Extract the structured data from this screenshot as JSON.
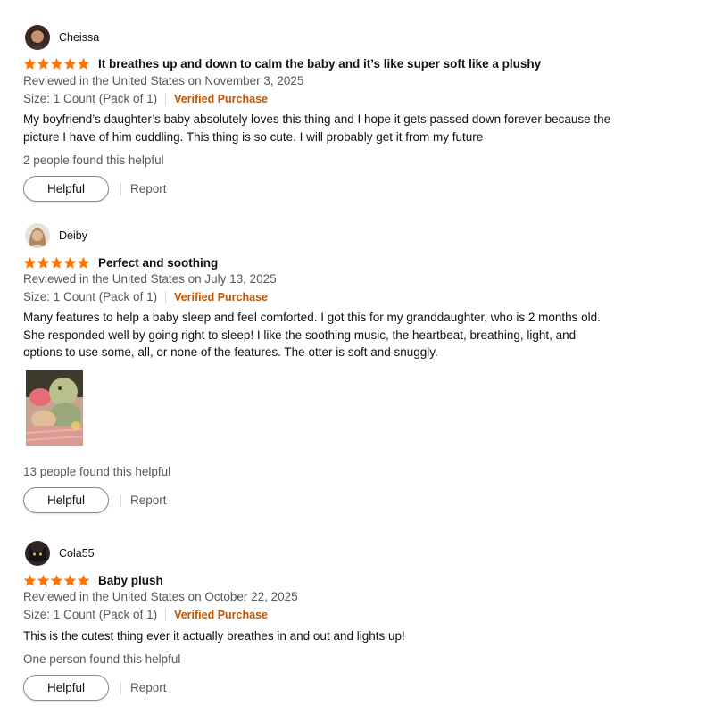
{
  "reviews": [
    {
      "username": "Cheissa",
      "avatar_icon": "user-avatar",
      "rating": 5,
      "title": "It breathes up and down to calm the baby and it’s like super soft like a plushy",
      "meta": "Reviewed in the United States on November 3, 2025",
      "size": "Size: 1 Count (Pack of 1)",
      "verified": "Verified Purchase",
      "body": "My boyfriend’s daughter’s baby absolutely loves this thing and I hope it gets passed down forever because the picture I have of him cuddling. This thing is so cute. I will probably get it from my future",
      "helpful_text": "2 people found this helpful",
      "helpful_label": "Helpful",
      "report_label": "Report"
    },
    {
      "username": "Deiby",
      "avatar_icon": "user-avatar",
      "rating": 5,
      "title": "Perfect and soothing",
      "meta": "Reviewed in the United States on July 13, 2025",
      "size": "Size: 1 Count (Pack of 1)",
      "verified": "Verified Purchase",
      "body": "Many features to help a baby sleep and feel comforted. I got this for my granddaughter, who is 2 months old. She responded well by going right to sleep! I like the soothing music, the heartbeat, breathing, light, and options to use some, all, or none of the features. The otter is soft and snuggly.",
      "helpful_text": "13 people found this helpful",
      "helpful_label": "Helpful",
      "report_label": "Report"
    },
    {
      "username": "Cola55",
      "avatar_icon": "user-avatar",
      "rating": 5,
      "title": "Baby plush",
      "meta": "Reviewed in the United States on October 22, 2025",
      "size": "Size: 1 Count (Pack of 1)",
      "verified": "Verified Purchase",
      "body": "This is the cutest thing ever it actually breathes in and out and lights up!",
      "helpful_text": "One person found this helpful",
      "helpful_label": "Helpful",
      "report_label": "Report"
    }
  ],
  "colors": {
    "star": "#ff7300",
    "verified": "#c45500",
    "muted": "#565959",
    "text": "#0f1111"
  }
}
